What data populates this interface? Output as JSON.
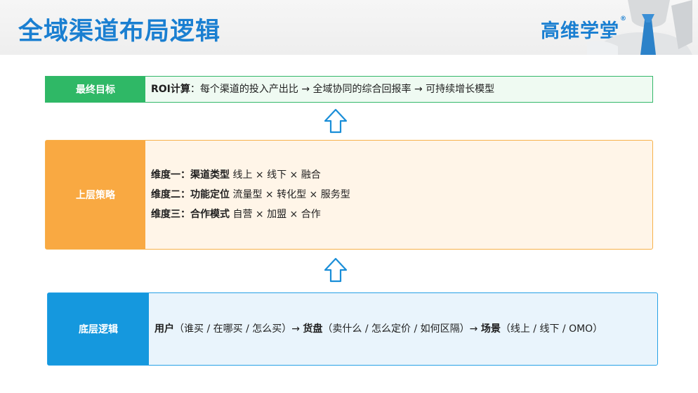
{
  "header": {
    "title": "全域渠道布局逻辑",
    "brand": "高维学堂",
    "brand_mark": "®"
  },
  "rows": {
    "goal": {
      "label": "最终目标",
      "lead": "ROI计算",
      "text": "：每个渠道的投入产出比 → 全域协同的综合回报率 → 可持续增长模型"
    },
    "upper": {
      "label": "上层策略",
      "lines": [
        {
          "lead": "维度一：渠道类型",
          "text": " 线上 × 线下 × 融合"
        },
        {
          "lead": "维度二：功能定位",
          "text": " 流量型 × 转化型 × 服务型"
        },
        {
          "lead": "维度三：合作模式",
          "text": " 自营 × 加盟 × 合作"
        }
      ]
    },
    "base": {
      "label": "底层逻辑",
      "segments": [
        {
          "lead": "用户",
          "text": "（谁买 / 在哪买 / 怎么买）→ "
        },
        {
          "lead": "货盘",
          "text": "（卖什么 / 怎么定价 / 如何区隔）→ "
        },
        {
          "lead": "场景",
          "text": "（线上 / 线下 / OMO）"
        }
      ]
    }
  },
  "colors": {
    "title": "#1a7fd1",
    "goal": "#2fb866",
    "upper": "#f9a942",
    "base": "#1598de",
    "arrow": "#1a8ed8"
  },
  "icons": [
    "up-arrow-icon",
    "mascot-figure"
  ]
}
